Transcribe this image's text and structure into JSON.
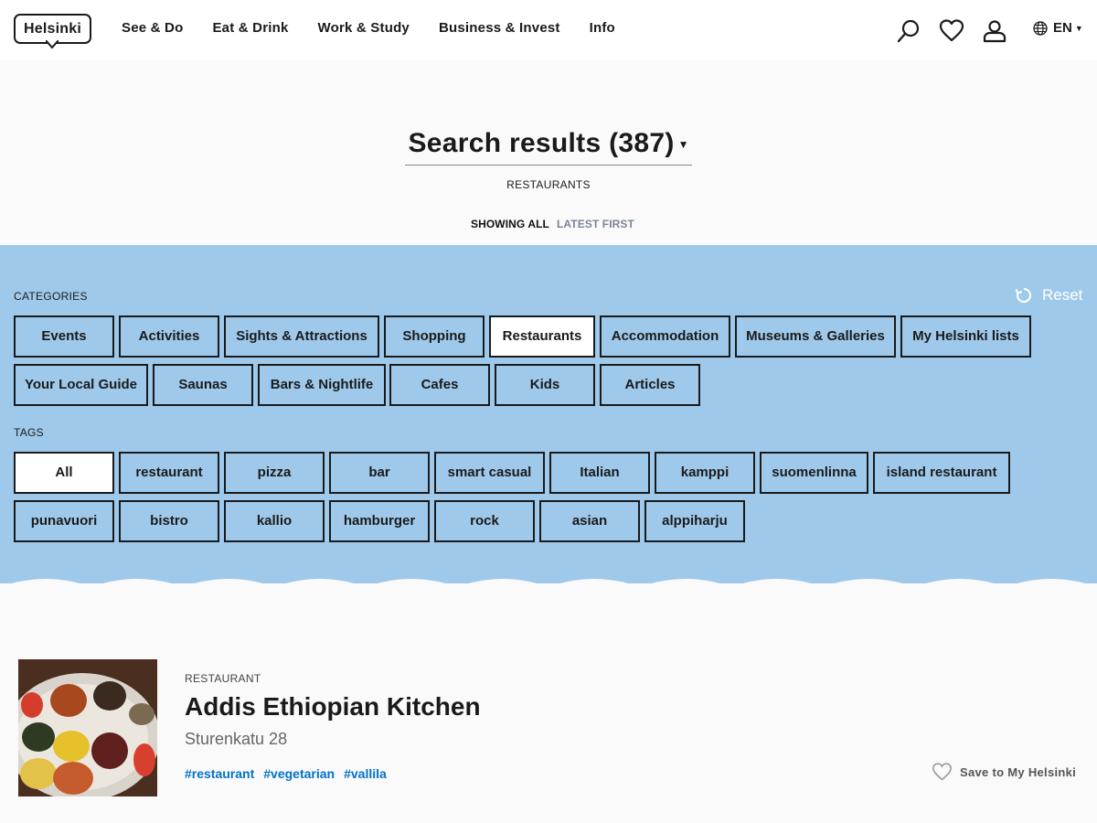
{
  "header": {
    "logo_text": "Helsinki",
    "nav": [
      "See & Do",
      "Eat & Drink",
      "Work & Study",
      "Business & Invest",
      "Info"
    ],
    "language": "EN"
  },
  "results": {
    "title": "Search results (387)",
    "category": "RESTAURANTS",
    "sort_all": "SHOWING ALL",
    "sort_latest": "LATEST FIRST"
  },
  "filters": {
    "categories_label": "CATEGORIES",
    "reset_label": "Reset",
    "categories": [
      "Events",
      "Activities",
      "Sights & Attractions",
      "Shopping",
      "Restaurants",
      "Accommodation",
      "Museums & Galleries",
      "My Helsinki lists",
      "Your Local Guide",
      "Saunas",
      "Bars & Nightlife",
      "Cafes",
      "Kids",
      "Articles"
    ],
    "active_category": "Restaurants",
    "tags_label": "TAGS",
    "tags": [
      "All",
      "restaurant",
      "pizza",
      "bar",
      "smart casual",
      "Italian",
      "kamppi",
      "suomenlinna",
      "island restaurant",
      "punavuori",
      "bistro",
      "kallio",
      "hamburger",
      "rock",
      "asian",
      "alppiharju"
    ],
    "active_tag": "All"
  },
  "result_item": {
    "type": "RESTAURANT",
    "title": "Addis Ethiopian Kitchen",
    "address": "Sturenkatu 28",
    "tags": [
      "#restaurant",
      "#vegetarian",
      "#vallila"
    ],
    "save_label": "Save to My Helsinki"
  },
  "colors": {
    "panel": "#9fc9eb",
    "link": "#0072c6",
    "text": "#1a1a1a"
  }
}
